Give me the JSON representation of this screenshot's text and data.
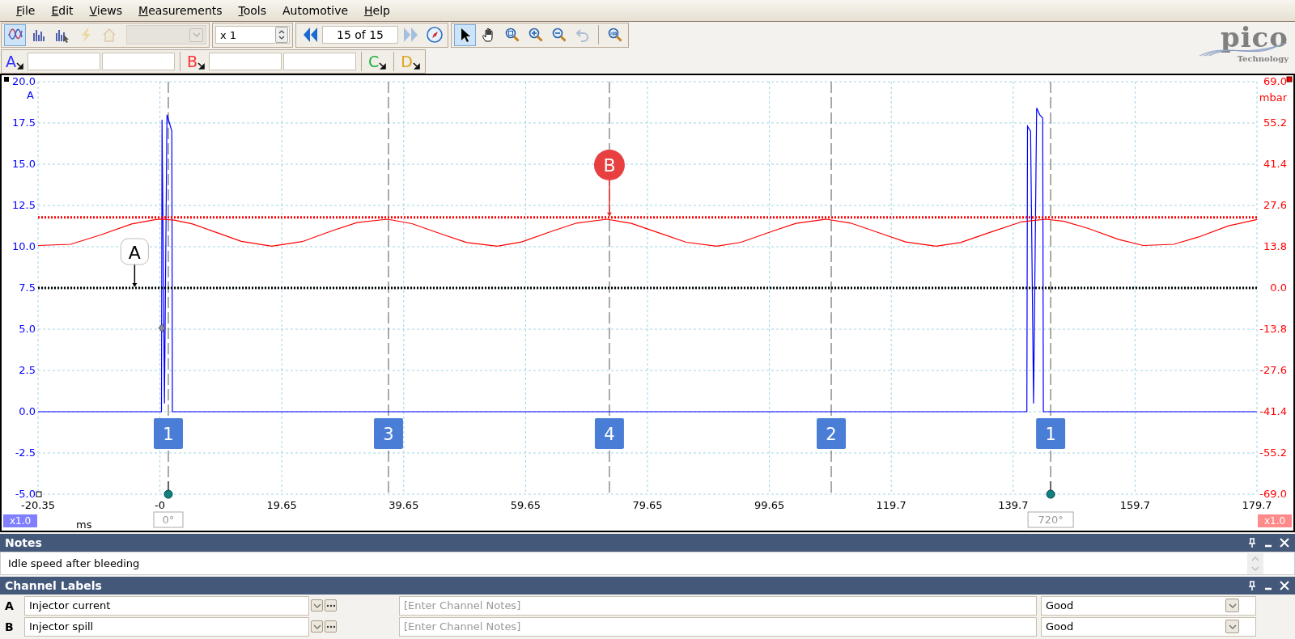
{
  "menu": [
    {
      "label": "File",
      "access_key": true
    },
    {
      "label": "Edit",
      "access_key": true
    },
    {
      "label": "Views",
      "access_key": true
    },
    {
      "label": "Measurements",
      "access_key": true
    },
    {
      "label": "Tools",
      "access_key": true
    },
    {
      "label": "Automotive",
      "access_key": false
    },
    {
      "label": "Help",
      "access_key": true
    }
  ],
  "toolbar": {
    "mode_buttons": [
      {
        "selected": true,
        "disabled": false
      },
      {
        "selected": false,
        "disabled": false
      },
      {
        "selected": false,
        "disabled": false
      },
      {
        "selected": false,
        "disabled": true
      },
      {
        "selected": false,
        "disabled": true
      }
    ],
    "capture_select": {
      "disabled": true
    },
    "zoom_factor": {
      "value": "x 1"
    },
    "buffer_nav": {
      "prev_disabled": false,
      "position": "15 of 15",
      "next_disabled": true
    },
    "tools": [
      {
        "selected": true,
        "disabled": false
      },
      {
        "selected": false,
        "disabled": false
      },
      {
        "selected": false,
        "disabled": false
      },
      {
        "selected": false,
        "disabled": false
      },
      {
        "selected": false,
        "disabled": false
      },
      {
        "selected": false,
        "disabled": true
      },
      {
        "selected": false,
        "disabled": false
      }
    ]
  },
  "channel_toolbar": [
    {
      "letter": "A",
      "color": "#3030ff",
      "kind": "ranged"
    },
    {
      "letter": "B",
      "color": "#ff3030",
      "kind": "ranged"
    },
    {
      "letter": "C",
      "color": "#20b040",
      "kind": "plain"
    },
    {
      "letter": "D",
      "color": "#e0a020",
      "kind": "plain"
    }
  ],
  "logo": {
    "name": "pico",
    "tagline": "Technology"
  },
  "plot": {
    "current": {
      "chart_data": {
        "type": "line",
        "grid": true,
        "xlabel": "ms",
        "ylabel": "A",
        "xlim": [
          -20.35,
          179.65
        ],
        "ylim": [
          -5,
          20
        ],
        "xticks": [
          {
            "value": -20.35,
            "label": "-20.35"
          },
          {
            "value": -0.35,
            "label": "-0"
          },
          {
            "value": 19.65,
            "label": "19.65"
          },
          {
            "value": 39.65,
            "label": "39.65"
          },
          {
            "value": 59.65,
            "label": "59.65"
          },
          {
            "value": 79.65,
            "label": "79.65"
          },
          {
            "value": 99.65,
            "label": "99.65"
          },
          {
            "value": 119.65,
            "label": "119.7"
          },
          {
            "value": 139.65,
            "label": "139.7"
          },
          {
            "value": 159.65,
            "label": "159.7"
          },
          {
            "value": 179.65,
            "label": "179.7"
          }
        ],
        "yticks": [
          {
            "value": 20,
            "label": "20.0"
          },
          {
            "value": 17.5,
            "label": "17.5"
          },
          {
            "value": 15,
            "label": "15.0"
          },
          {
            "value": 12.5,
            "label": "12.5"
          },
          {
            "value": 10,
            "label": "10.0"
          },
          {
            "value": 7.5,
            "label": "7.5"
          },
          {
            "value": 5,
            "label": "5.0"
          },
          {
            "value": 2.5,
            "label": "2.5"
          },
          {
            "value": 0,
            "label": "0.0"
          },
          {
            "value": -2.5,
            "label": "-2.5"
          },
          {
            "value": -5,
            "label": "-5.0"
          }
        ],
        "x": [
          -20.35,
          -15,
          -10,
          -5,
          -0.1,
          0,
          0.4,
          0.8,
          1.2,
          1.6,
          1.7,
          5,
          9,
          13,
          18,
          23,
          28,
          32,
          37,
          41,
          46,
          50,
          55,
          59,
          64,
          68,
          73,
          77,
          82,
          86,
          91,
          95,
          100,
          104,
          109,
          113,
          118,
          122,
          127,
          131,
          136,
          141.9,
          142,
          142.5,
          143,
          143.5,
          144,
          144.5,
          144.6,
          152,
          157,
          161,
          166,
          170,
          175,
          179.65
        ],
        "series": [
          {
            "color": "#0000ff",
            "values": [
              0,
              0,
              0,
              0,
              0,
              17.7,
              0.5,
              18.0,
              17.5,
              17.0,
              0,
              0,
              0,
              0,
              0,
              0,
              0,
              0,
              0,
              0,
              0,
              0,
              0,
              0,
              0,
              0,
              0,
              0,
              0,
              0,
              0,
              0,
              0,
              0,
              0,
              0,
              0,
              0,
              0,
              0,
              0,
              0,
              17.3,
              17.0,
              0.5,
              18.4,
              18.0,
              17.8,
              0,
              0,
              0,
              0,
              0,
              0,
              0,
              0
            ]
          }
        ]
      }
    },
    "pressure": {
      "chart_data": {
        "type": "line",
        "ylabel": "mbar",
        "xlim": [
          -20.35,
          179.65
        ],
        "ylim": [
          -69,
          69
        ],
        "yticks": [
          {
            "value": 69,
            "label": "69.0"
          },
          {
            "value": 55.2,
            "label": "55.2"
          },
          {
            "value": 41.4,
            "label": "41.4"
          },
          {
            "value": 27.6,
            "label": "27.6"
          },
          {
            "value": 13.8,
            "label": "13.8"
          },
          {
            "value": 0,
            "label": "0.0"
          },
          {
            "value": -13.8,
            "label": "-13.8"
          },
          {
            "value": -27.6,
            "label": "-27.6"
          },
          {
            "value": -41.4,
            "label": "-41.4"
          },
          {
            "value": -55.2,
            "label": "-55.2"
          },
          {
            "value": -69,
            "label": "-69.0"
          }
        ],
        "x": [
          -20.35,
          -15,
          -10,
          -5,
          -1,
          0,
          2,
          5,
          9,
          13,
          18,
          23,
          28,
          32,
          37,
          41,
          46,
          50,
          55,
          59,
          64,
          68,
          73,
          77,
          82,
          86,
          91,
          95,
          100,
          104,
          109,
          113,
          118,
          122,
          127,
          131,
          136,
          141,
          145,
          148,
          152,
          157,
          161,
          166,
          170,
          175,
          179.65
        ],
        "series": [
          {
            "color": "#ff0000",
            "values": [
              14.2,
              14.6,
              17.8,
              21.4,
              22.9,
              23.0,
              22.7,
              21.4,
              18.5,
              15.6,
              14.0,
              15.5,
              19.2,
              21.9,
              23.0,
              21.5,
              17.9,
              15.2,
              14.0,
              15.4,
              19.0,
              21.7,
              23.0,
              21.6,
              18.1,
              15.3,
              14.0,
              15.3,
              18.9,
              21.6,
              23.0,
              21.7,
              18.2,
              15.4,
              14.0,
              15.2,
              18.7,
              22.1,
              23.0,
              22.3,
              19.9,
              16.2,
              14.2,
              14.6,
              17.0,
              20.8,
              22.9
            ]
          }
        ]
      }
    },
    "rulers": [
      {
        "label": "A",
        "kind": "current"
      },
      {
        "label": "B",
        "kind": "pressure"
      }
    ],
    "markers": [
      {
        "label": "1"
      },
      {
        "label": "3"
      },
      {
        "label": "4"
      },
      {
        "label": "2"
      },
      {
        "label": "1"
      }
    ],
    "rotation_rulers": [
      {
        "label": "0°"
      },
      {
        "label": "720°"
      }
    ],
    "channel_scales": [
      {
        "text": "x1.0",
        "color": "#8080ff"
      },
      {
        "text": "x1.0",
        "color": "#ff8a8a"
      }
    ]
  },
  "notes": {
    "title": "Notes",
    "text": "Idle speed after bleeding"
  },
  "channel_labels": {
    "title": "Channel Labels",
    "rows": [
      {
        "channel": "A",
        "label": "Injector current",
        "notes_placeholder": "[Enter Channel Notes]",
        "status": "Good"
      },
      {
        "channel": "B",
        "label": "Injector spill",
        "notes_placeholder": "[Enter Channel Notes]",
        "status": "Good"
      }
    ]
  }
}
